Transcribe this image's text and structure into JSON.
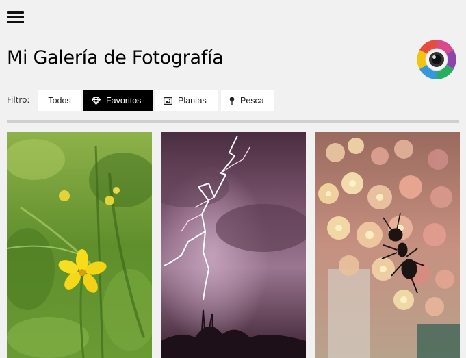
{
  "header": {
    "menu_icon": "hamburger-menu-icon",
    "title": "Mi Galería de Fotografía",
    "logo_icon": "camera-aperture-logo"
  },
  "filters": {
    "label": "Filtro:",
    "buttons": [
      {
        "label": "Todos",
        "icon": null,
        "active": false
      },
      {
        "label": "Favoritos",
        "icon": "diamond-icon",
        "active": true
      },
      {
        "label": "Plantas",
        "icon": "image-icon",
        "active": false
      },
      {
        "label": "Pesca",
        "icon": "map-pin-icon",
        "active": false
      }
    ]
  },
  "gallery": {
    "photos": [
      {
        "subject": "yellow-flower-photo"
      },
      {
        "subject": "lightning-storm-photo"
      },
      {
        "subject": "ant-on-flowers-photo"
      }
    ]
  },
  "colors": {
    "background": "#f1f1f1",
    "active_filter": "#000000",
    "divider": "#cfcfcf"
  }
}
